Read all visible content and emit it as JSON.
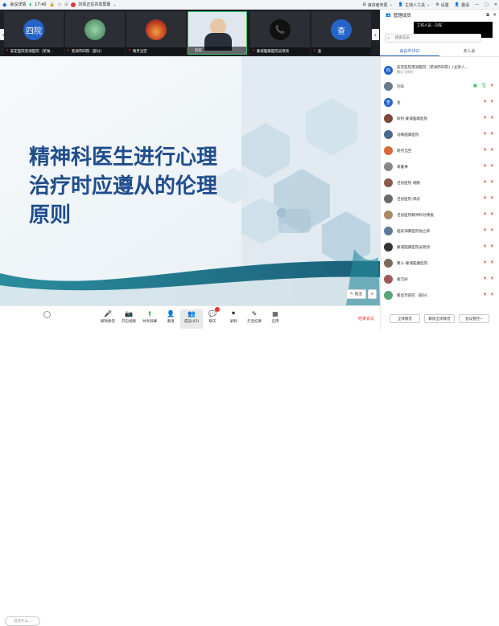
{
  "topbar": {
    "app": "会议详情",
    "time": "17:40",
    "sharing": "刘军正在共享屏幕",
    "right_items": [
      "演讲者布局",
      "主持人工具",
      "设置",
      "邀请",
      "管理成员"
    ]
  },
  "participants": [
    {
      "label": "安定医院芜湖医院（芜湖...",
      "avatar": "四院",
      "color": "#2463c7"
    },
    {
      "label": "芜湖市四院（部分）",
      "avatar": "",
      "color": "#5aa37a"
    },
    {
      "label": "晓月当空",
      "avatar": "",
      "color": "#d96a3a"
    },
    {
      "label": "刘军",
      "avatar": "",
      "color": "#6a7c8c"
    },
    {
      "label": "蒙城脑康医院吴晓亮",
      "avatar": "📞",
      "color": "#222"
    },
    {
      "label": "查",
      "avatar": "查",
      "color": "#2463c7"
    }
  ],
  "slide": {
    "title_lines": [
      "精神科医生进行心理",
      "治疗时应遵从的伦理",
      "原则"
    ],
    "annotate_label": "批注"
  },
  "bottombar": {
    "chat_placeholder": "说点什么...",
    "buttons": [
      {
        "label": "解除静音",
        "icon": "🎤"
      },
      {
        "label": "开启视频",
        "icon": "📷"
      },
      {
        "label": "共享屏幕",
        "icon": "⬆"
      },
      {
        "label": "邀请",
        "icon": "👤"
      },
      {
        "label": "成员(42)",
        "icon": "👥"
      },
      {
        "label": "聊天",
        "icon": "💬"
      },
      {
        "label": "录制",
        "icon": "⏺"
      },
      {
        "label": "元宝纪要",
        "icon": "✎"
      },
      {
        "label": "应用",
        "icon": "▦"
      }
    ],
    "end_label": "结束会议"
  },
  "panel": {
    "title": "管理成员",
    "tooltip": "工作人员 · 刘军",
    "search_placeholder": "搜索成员",
    "tabs": [
      "会议中(42)",
      "未入会"
    ],
    "members": [
      {
        "name": "安定医院芜湖医院（芜湖市四院）(主持人, 我)",
        "sub": "腾讯飞鸽的",
        "color": "#2463c7",
        "avatar": "四"
      },
      {
        "name": "刘军",
        "color": "#6a7c8c",
        "avatar": ""
      },
      {
        "name": "查",
        "color": "#2463c7",
        "avatar": "查"
      },
      {
        "name": "耿利 蒙城脑康医院",
        "color": "#7a4a3a",
        "avatar": ""
      },
      {
        "name": "马鞍脑康医院",
        "color": "#4a6a8a",
        "avatar": ""
      },
      {
        "name": "晓月当空",
        "color": "#d96a3a",
        "avatar": ""
      },
      {
        "name": "蒋董事",
        "color": "#888",
        "avatar": ""
      },
      {
        "name": "泾县医院 胡鹏",
        "color": "#8a5a4a",
        "avatar": ""
      },
      {
        "name": "泾县医院-揭云",
        "color": "#6a6a6a",
        "avatar": ""
      },
      {
        "name": "泾县医院精神科付锦俊",
        "color": "#aa8866",
        "avatar": ""
      },
      {
        "name": "临泉海豚医院张立荣",
        "color": "#5a7a9a",
        "avatar": ""
      },
      {
        "name": "蒙城脑康医院吴晓亮",
        "color": "#333",
        "avatar": ""
      },
      {
        "name": "鹰斗-蒙城脑康医院",
        "color": "#7a6a5a",
        "avatar": ""
      },
      {
        "name": "秦沉好",
        "color": "#9a5a5a",
        "avatar": ""
      },
      {
        "name": "繁昌市四院（部分）",
        "color": "#5aa37a",
        "avatar": ""
      }
    ],
    "mute_all": "全体静音",
    "unmute_all": "解除全体静音",
    "more": "会议管控"
  }
}
